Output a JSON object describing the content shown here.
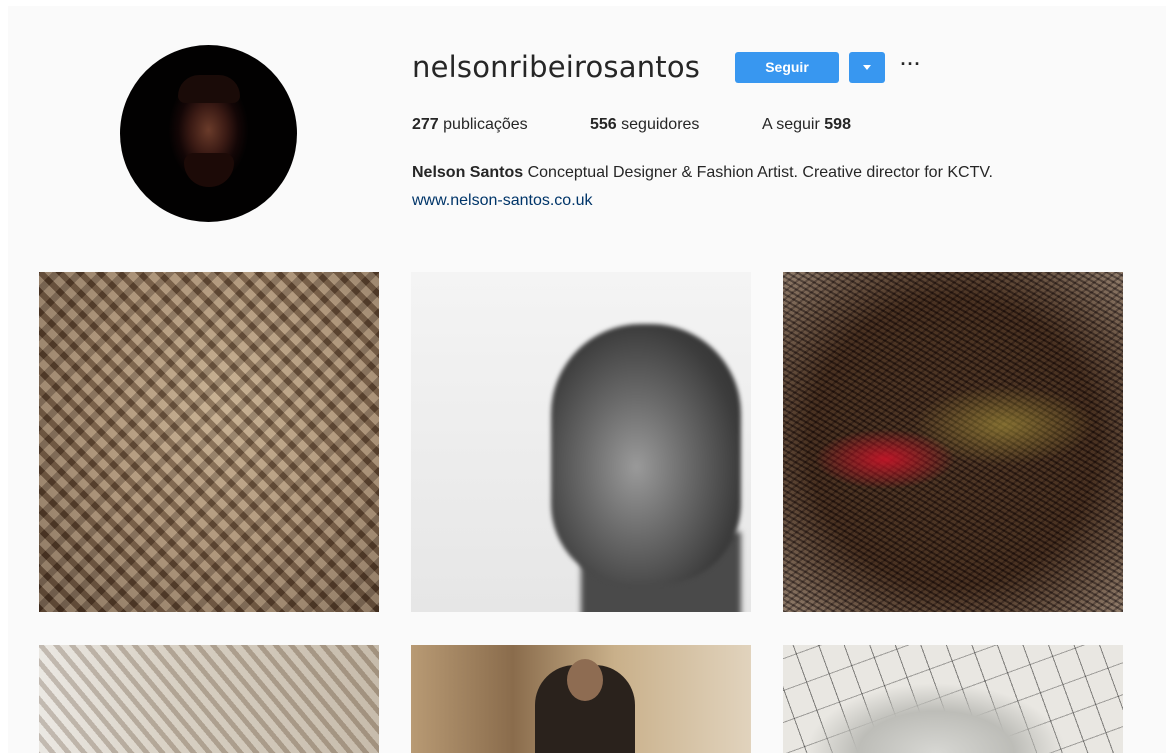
{
  "profile": {
    "username": "nelsonribeirosantos",
    "follow_label": "Seguir",
    "more_label": "···",
    "stats": {
      "posts_count": "277",
      "posts_label": "publicações",
      "followers_count": "556",
      "followers_label": "seguidores",
      "following_label": "A seguir",
      "following_count": "598"
    },
    "bio": {
      "name": "Nelson Santos",
      "text": "Conceptual Designer & Fashion Artist. Creative director for KCTV."
    },
    "website": "www.nelson-santos.co.uk"
  },
  "colors": {
    "accent": "#3897f0",
    "link": "#003569",
    "background": "#fafafa"
  },
  "icons": {
    "dropdown": "chevron-down-icon",
    "more": "more-options-icon"
  }
}
